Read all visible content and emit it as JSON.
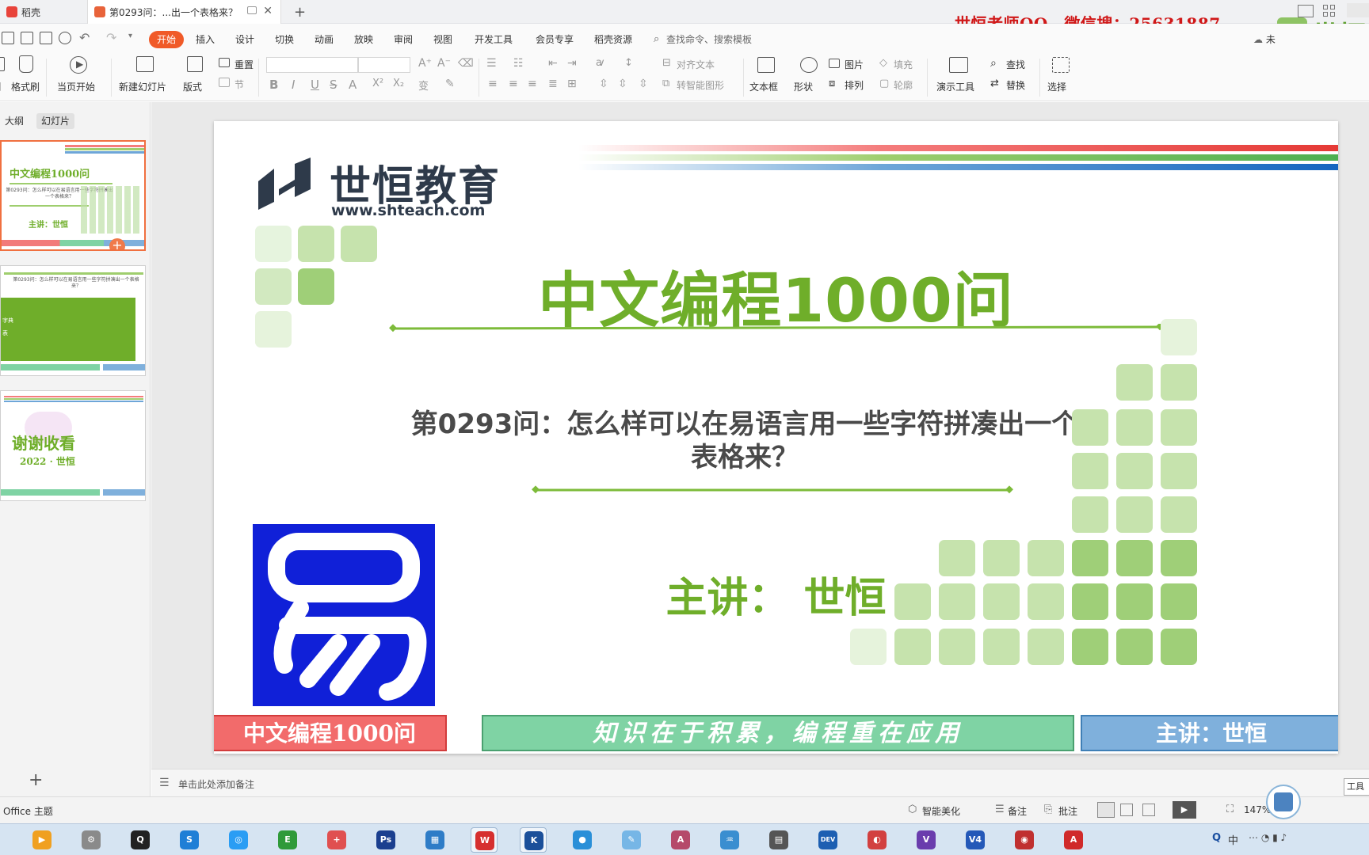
{
  "window": {
    "tabs": [
      {
        "label": "稻壳",
        "active": false
      },
      {
        "label": "第0293问：...出一个表格来？",
        "active": true
      }
    ],
    "new_tab": "+",
    "promo_text": "世恒老师QQ、微信搜：25631887"
  },
  "menu": {
    "items": [
      "开始",
      "插入",
      "设计",
      "切换",
      "动画",
      "放映",
      "审阅",
      "视图",
      "开发工具",
      "会员专享",
      "稻壳资源"
    ],
    "active": "开始",
    "search_placeholder": "查找命令、搜索模板",
    "share_label": "未"
  },
  "ribbon": {
    "format_painter": "格式刷",
    "from_current": "当页开始",
    "new_slide": "新建幻灯片",
    "layout": "版式",
    "reset": "重置",
    "section": "节",
    "align_text": "对齐文本",
    "smart_shape": "转智能图形",
    "textbox": "文本框",
    "shape": "形状",
    "picture": "图片",
    "arrange": "排列",
    "fill": "填充",
    "outline": "轮廓",
    "present_tools": "演示工具",
    "find": "查找",
    "replace": "替换",
    "select": "选择",
    "bold": "B",
    "italic": "I",
    "underline": "U",
    "strike": "S",
    "font_color": "A",
    "superscript": "X²",
    "subscript": "X₂",
    "pinyin": "变"
  },
  "left_panel": {
    "tabs": [
      "大纲",
      "幻灯片"
    ],
    "active_tab": "幻灯片",
    "thumb1": {
      "title": "中文编程1000问",
      "subtitle": "第0293问：怎么样可以在易语言用一些字符拼凑出一个表格来？",
      "presenter": "主讲：世恒"
    },
    "thumb2": {
      "subtitle": "第0293问：怎么样可以在易语言用一些字符拼凑出一个表格来？",
      "line1": "字典",
      "line2": "表"
    },
    "thumb3": {
      "title": "谢谢收看",
      "subtitle": "2022 · 世恒"
    },
    "add_slide": "+"
  },
  "slide": {
    "logo_name": "世恒教育",
    "logo_url": "www.shteach.com",
    "title": "中文编程1000问",
    "question": "第0293问：怎么样可以在易语言用一些字符拼凑出一个表格来？",
    "presenter": "主讲：  世恒",
    "footer_left": "中文编程1000问",
    "footer_mid": "知识在于积累，编程重在应用",
    "footer_right": "主讲：世恒",
    "yi_logo_alt": "易",
    "colors": {
      "green": "#6fae2a",
      "footer_red": "#f26b6b",
      "footer_green": "#7fd3a4",
      "footer_blue": "#7fb0dc"
    }
  },
  "notes": {
    "placeholder": "单击此处添加备注"
  },
  "status": {
    "theme": "Office 主题",
    "beautify": "智能美化",
    "notes_btn": "备注",
    "comment_btn": "批注",
    "zoom": "147%",
    "toolbox": "工具"
  },
  "taskbar": {
    "apps": [
      "media-player",
      "flash-tool",
      "qq",
      "sogou",
      "baidu-netdisk",
      "easy-language",
      "adder",
      "photoshop",
      "tool-blue",
      "wps",
      "ide",
      "chat-bubble",
      "notepad",
      "pdf-tool",
      "fish",
      "chip-tool",
      "dev-cpp",
      "paint",
      "visual-studio",
      "v4",
      "recorder",
      "font-tool"
    ],
    "ime": "中",
    "tray_q": "Q"
  }
}
